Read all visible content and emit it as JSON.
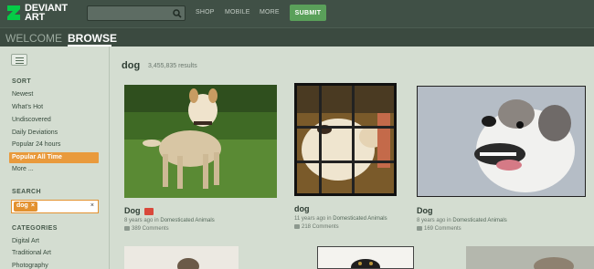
{
  "brand": {
    "line1": "DEVIANT",
    "line2": "ART"
  },
  "topnav": {
    "search_placeholder": "",
    "shop": "SHOP",
    "mobile": "MOBILE",
    "more": "MORE",
    "submit": "SUBMIT"
  },
  "subnav": {
    "welcome": "WELCOME",
    "browse": "BROWSE"
  },
  "sidebar": {
    "sort_heading": "SORT",
    "sort_items": [
      "Newest",
      "What's Hot",
      "Undiscovered",
      "Daily Deviations",
      "Popular 24 hours",
      "Popular All Time",
      "More ..."
    ],
    "search_heading": "SEARCH",
    "search_tag": "dog",
    "search_tag_remove": "×",
    "search_clear": "×",
    "categories_heading": "CATEGORIES",
    "category_items": [
      "Digital Art",
      "Traditional Art",
      "Photography"
    ]
  },
  "results": {
    "query": "dog",
    "count": "3,455,835 results",
    "cards": [
      {
        "title": "Dog",
        "meta": "8 years ago in ",
        "category": "Domesticated Animals",
        "comments": "389 Comments"
      },
      {
        "title": "dog",
        "meta": "11 years ago in ",
        "category": "Domesticated Animals",
        "comments": "218 Comments"
      },
      {
        "title": "Dog",
        "meta": "8 years ago in ",
        "category": "Domesticated Animals",
        "comments": "169 Comments"
      }
    ]
  },
  "colors": {
    "topbar": "#405046",
    "accent": "#e99a3c",
    "submit": "#5aa05a",
    "background": "#d4ddd1"
  }
}
